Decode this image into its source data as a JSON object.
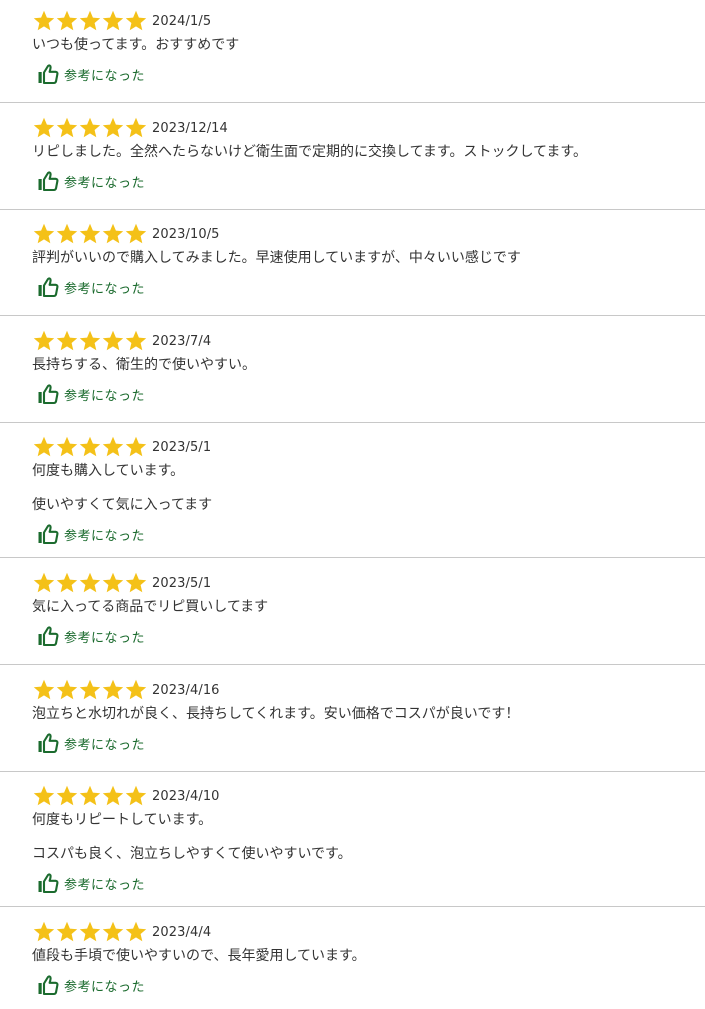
{
  "reviews": [
    {
      "rating": 5,
      "date": "2024/1/5",
      "lines": [
        "いつも使ってます。おすすめです"
      ],
      "helpful_label": "参考になった"
    },
    {
      "rating": 5,
      "date": "2023/12/14",
      "lines": [
        "リピしました。全然へたらないけど衛生面で定期的に交換してます。ストックしてます。"
      ],
      "helpful_label": "参考になった"
    },
    {
      "rating": 5,
      "date": "2023/10/5",
      "lines": [
        "評判がいいので購入してみました。早速使用していますが、中々いい感じです"
      ],
      "helpful_label": "参考になった"
    },
    {
      "rating": 5,
      "date": "2023/7/4",
      "lines": [
        "長持ちする、衛生的で使いやすい。"
      ],
      "helpful_label": "参考になった"
    },
    {
      "rating": 5,
      "date": "2023/5/1",
      "lines": [
        "何度も購入しています。",
        "使いやすくて気に入ってます"
      ],
      "helpful_label": "参考になった"
    },
    {
      "rating": 5,
      "date": "2023/5/1",
      "lines": [
        "気に入ってる商品でリピ買いしてます"
      ],
      "helpful_label": "参考になった"
    },
    {
      "rating": 5,
      "date": "2023/4/16",
      "lines": [
        "泡立ちと水切れが良く、長持ちしてくれます。安い価格でコスパが良いです！"
      ],
      "helpful_label": "参考になった"
    },
    {
      "rating": 5,
      "date": "2023/4/10",
      "lines": [
        "何度もリピートしています。",
        "コスパも良く、泡立ちしやすくて使いやすいです。"
      ],
      "helpful_label": "参考になった"
    },
    {
      "rating": 5,
      "date": "2023/4/4",
      "lines": [
        "値段も手頃で使いやすいので、長年愛用しています。"
      ],
      "helpful_label": "参考になった"
    }
  ],
  "colors": {
    "star": "#f4c118",
    "helpful": "#1b6b2e",
    "divider": "#c8c8c8"
  },
  "icons": {
    "star": "star-icon",
    "helpful": "thumbs-up-icon"
  }
}
